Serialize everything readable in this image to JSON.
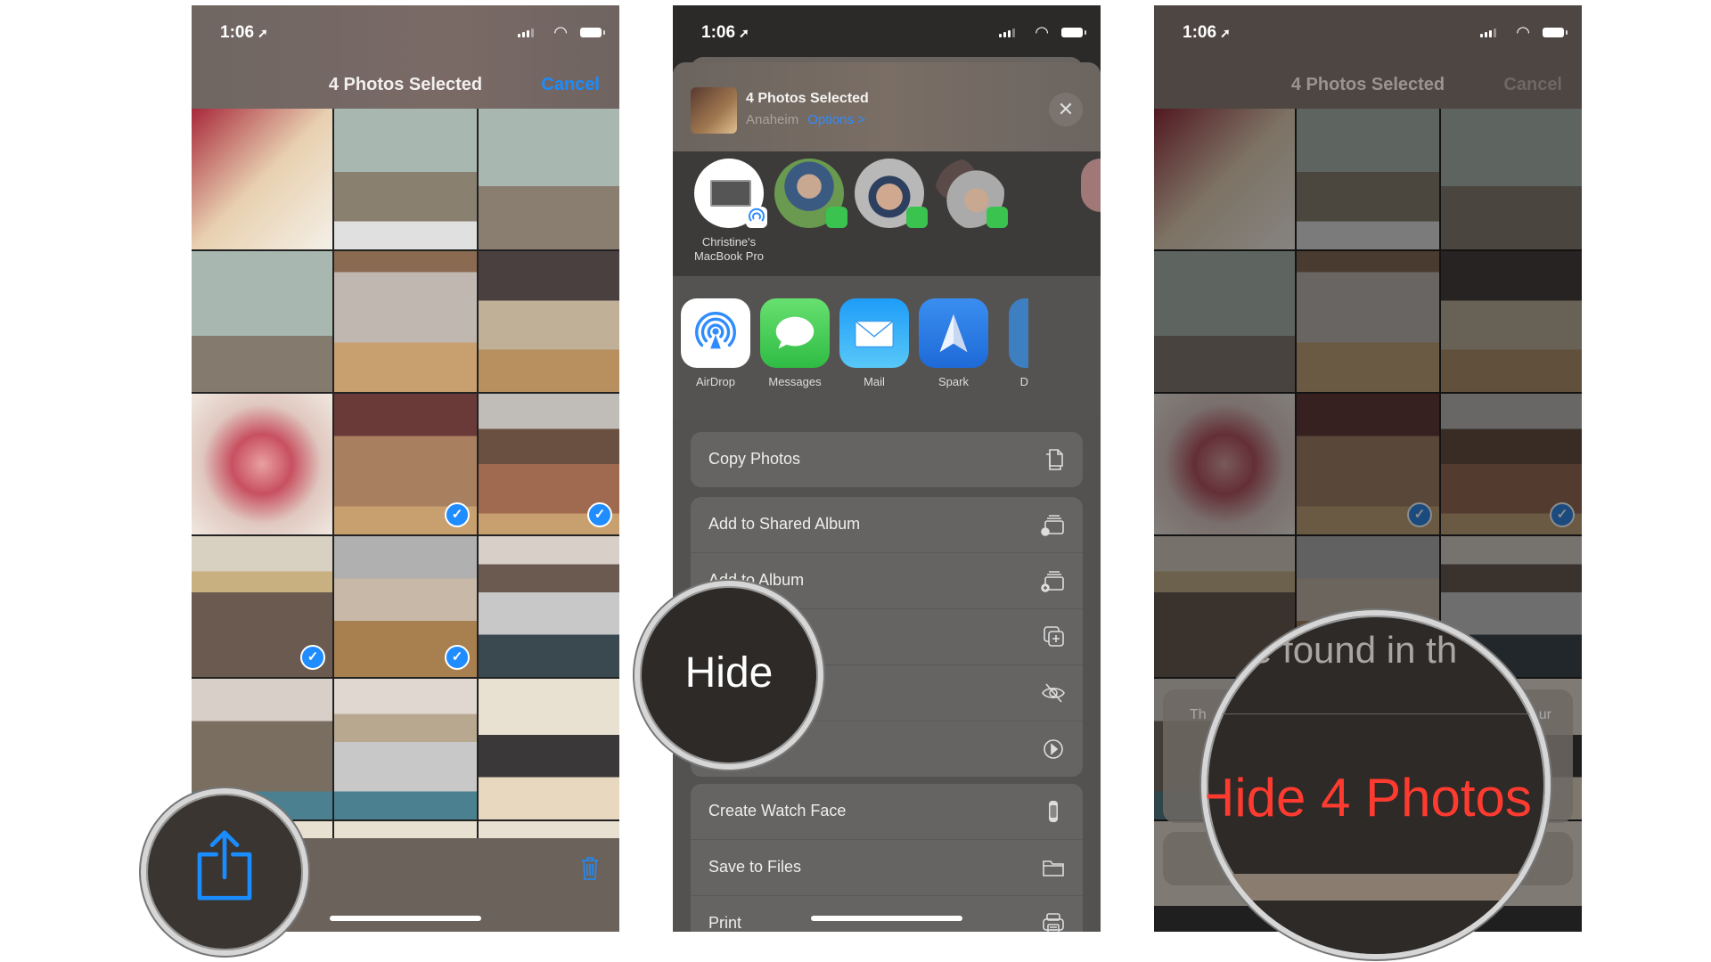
{
  "status_bar": {
    "time": "1:06",
    "location_arrow": "location-arrow-icon"
  },
  "phone1": {
    "nav": {
      "title": "4 Photos Selected",
      "cancel_label": "Cancel"
    },
    "grid": {
      "tiles": [
        {
          "subject": "birthday cake",
          "selected": false
        },
        {
          "subject": "cat on wall near car",
          "selected": false
        },
        {
          "subject": "cat on wall",
          "selected": false
        },
        {
          "subject": "cat on steps",
          "selected": false
        },
        {
          "subject": "microwave on cart in room",
          "selected": false
        },
        {
          "subject": "microwave on cart close",
          "selected": false
        },
        {
          "subject": "sashimi plate",
          "selected": false
        },
        {
          "subject": "metal shelf",
          "selected": true
        },
        {
          "subject": "microwave on shelf with snacks",
          "selected": true
        },
        {
          "subject": "kitchen cart",
          "selected": true
        },
        {
          "subject": "sous vide container",
          "selected": true
        },
        {
          "subject": "man holding dog",
          "selected": false
        },
        {
          "subject": "sleeping dog",
          "selected": false
        },
        {
          "subject": "man holding dog",
          "selected": false
        },
        {
          "subject": "dog on couch",
          "selected": false
        },
        {
          "subject": "dog on couch",
          "selected": false
        },
        {
          "subject": "dog on couch",
          "selected": false
        },
        {
          "subject": "dog on couch",
          "selected": false
        }
      ]
    },
    "toolbar": {
      "share_icon": "share-icon",
      "trash_icon": "trash-icon"
    }
  },
  "phone2": {
    "sheet": {
      "title": "4 Photos Selected",
      "location": "Anaheim",
      "options_label": "Options >",
      "close_label": "✕"
    },
    "people": [
      {
        "label": "Christine's MacBook Pro",
        "badge": "airdrop"
      },
      {
        "label": "",
        "badge": "messages"
      },
      {
        "label": "",
        "badge": "messages"
      },
      {
        "label": "",
        "badge": "messages"
      }
    ],
    "apps": [
      {
        "label": "AirDrop",
        "color": "#ffffff"
      },
      {
        "label": "Messages",
        "color": "#3ac34f"
      },
      {
        "label": "Mail",
        "color": "#2f8cf6"
      },
      {
        "label": "Spark",
        "color": "#2b7ee8"
      },
      {
        "label": "D",
        "color": "#3d7fc0"
      }
    ],
    "actions_group1": [
      {
        "label": "Copy Photos",
        "icon": "copy-icon"
      }
    ],
    "actions_group2": [
      {
        "label": "Add to Shared Album",
        "icon": "shared-album-icon"
      },
      {
        "label": "Add to Album",
        "icon": "add-album-icon"
      },
      {
        "label": "",
        "icon": "duplicate-icon"
      },
      {
        "label": "",
        "icon": "hide-eye-icon"
      },
      {
        "label": "",
        "icon": "slideshow-play-icon"
      }
    ],
    "actions_group3": [
      {
        "label": "Create Watch Face",
        "icon": "watch-icon"
      },
      {
        "label": "Save to Files",
        "icon": "folder-icon"
      },
      {
        "label": "Print",
        "icon": "printer-icon"
      }
    ],
    "magnifier_label": "Hide"
  },
  "phone3": {
    "nav": {
      "title": "4 Photos Selected",
      "cancel_label": "Cancel"
    },
    "alert": {
      "message_fragment": "e found in th",
      "left_fragment": "Th",
      "right_fragment": "ur",
      "confirm_label": "Hide 4 Photos"
    }
  },
  "colors": {
    "accent_blue": "#1a8cff",
    "destructive_red": "#ff3b30",
    "sheet_bg": "#545250"
  }
}
